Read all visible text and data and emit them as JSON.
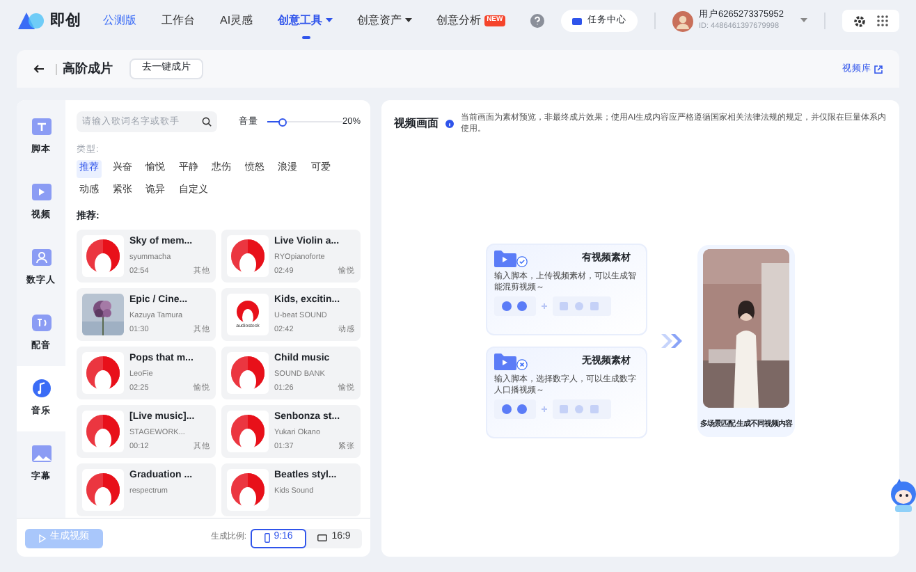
{
  "nav": {
    "logo": "即创",
    "badge": "公测版",
    "items": [
      {
        "label": "工作台",
        "selected": false,
        "dropdown": false
      },
      {
        "label": "AI灵感",
        "selected": false,
        "dropdown": false
      },
      {
        "label": "创意工具",
        "selected": true,
        "dropdown": true
      },
      {
        "label": "创意资产",
        "selected": false,
        "dropdown": true
      },
      {
        "label": "创意分析",
        "selected": false,
        "dropdown": false,
        "tag": "NEW"
      }
    ],
    "task_center": "任务中心",
    "user": {
      "name": "用户6265273375952",
      "id": "ID: 4486461397679998"
    }
  },
  "header": {
    "title": "高阶成片",
    "switch_button": "去一键成片",
    "library_link": "视频库"
  },
  "sidebar": [
    {
      "label": "脚本",
      "selected": false
    },
    {
      "label": "视频",
      "selected": false
    },
    {
      "label": "数字人",
      "selected": false
    },
    {
      "label": "配音",
      "selected": false
    },
    {
      "label": "音乐",
      "selected": true
    },
    {
      "label": "字幕",
      "selected": false
    }
  ],
  "music": {
    "search": {
      "placeholder": "请输入歌词名字或歌手"
    },
    "volume": {
      "label": "音量",
      "level": 0.2,
      "reading": "20%"
    },
    "category_label": "类型:",
    "categories": [
      {
        "label": "推荐",
        "selected": true
      },
      {
        "label": "兴奋",
        "selected": false
      },
      {
        "label": "愉悦",
        "selected": false
      },
      {
        "label": "平静",
        "selected": false
      },
      {
        "label": "悲伤",
        "selected": false
      },
      {
        "label": "愤怒",
        "selected": false
      },
      {
        "label": "浪漫",
        "selected": false
      },
      {
        "label": "可爱",
        "selected": false
      },
      {
        "label": "动感",
        "selected": false
      },
      {
        "label": "紧张",
        "selected": false
      },
      {
        "label": "诡异",
        "selected": false
      },
      {
        "label": "自定义",
        "selected": false
      }
    ],
    "list_title": "推荐:",
    "tracks": [
      {
        "title": "Sky of mem...",
        "artist": "syummacha",
        "duration": "02:54",
        "tag": "其他",
        "kind": "logo"
      },
      {
        "title": "Live Violin a...",
        "artist": "RYOpianoforte",
        "duration": "02:49",
        "tag": "愉悦",
        "kind": "logo"
      },
      {
        "title": "Epic / Cine...",
        "artist": "Kazuya Tamura",
        "duration": "01:30",
        "tag": "其他"
      },
      {
        "title": "Kids, excitin...",
        "artist": "U-beat SOUND",
        "duration": "02:42",
        "tag": "动感",
        "kind": "logo",
        "thumb_text": "audiostock"
      },
      {
        "title": "Pops that m...",
        "artist": "LeoFie",
        "duration": "02:25",
        "tag": "愉悦",
        "kind": "logo"
      },
      {
        "title": "Child music",
        "artist": "SOUND BANK",
        "duration": "01:26",
        "tag": "愉悦",
        "kind": "logo"
      },
      {
        "title": "[Live music]...",
        "artist": "STAGEWORK...",
        "duration": "00:12",
        "tag": "其他",
        "kind": "logo"
      },
      {
        "title": "Senbonza st...",
        "artist": "Yukari Okano",
        "duration": "01:37",
        "tag": "紧张",
        "kind": "logo"
      },
      {
        "title": "Graduation ...",
        "artist": "respectrum",
        "kind": "logo"
      },
      {
        "title": "Beatles styl...",
        "artist": "Kids Sound",
        "kind": "logo"
      }
    ]
  },
  "footer": {
    "generate_button": {
      "label": "生成视频",
      "disabled": true
    },
    "ratio_label": "生成比例:",
    "ratios": [
      {
        "label": "9:16",
        "selected": true,
        "kind": "portrait"
      },
      {
        "label": "16:9",
        "selected": false,
        "kind": "landscape"
      }
    ]
  },
  "preview": {
    "title": "视频画面",
    "notice": "当前画面为素材预览，非最终成片效果；使用AI生成内容应严格遵循国家相关法律法规的规定，并仅限在巨量体系内使用。",
    "options": [
      {
        "title": "有视频素材",
        "description": "输入脚本，上传视频素材，可以生成智能混剪视频～",
        "kind": "with"
      },
      {
        "title": "无视频素材",
        "description": "输入脚本，选择数字人，可以生成数字人口播视频～",
        "kind": "without"
      }
    ],
    "caption": "多场景匹配 生成不同视频内容"
  }
}
